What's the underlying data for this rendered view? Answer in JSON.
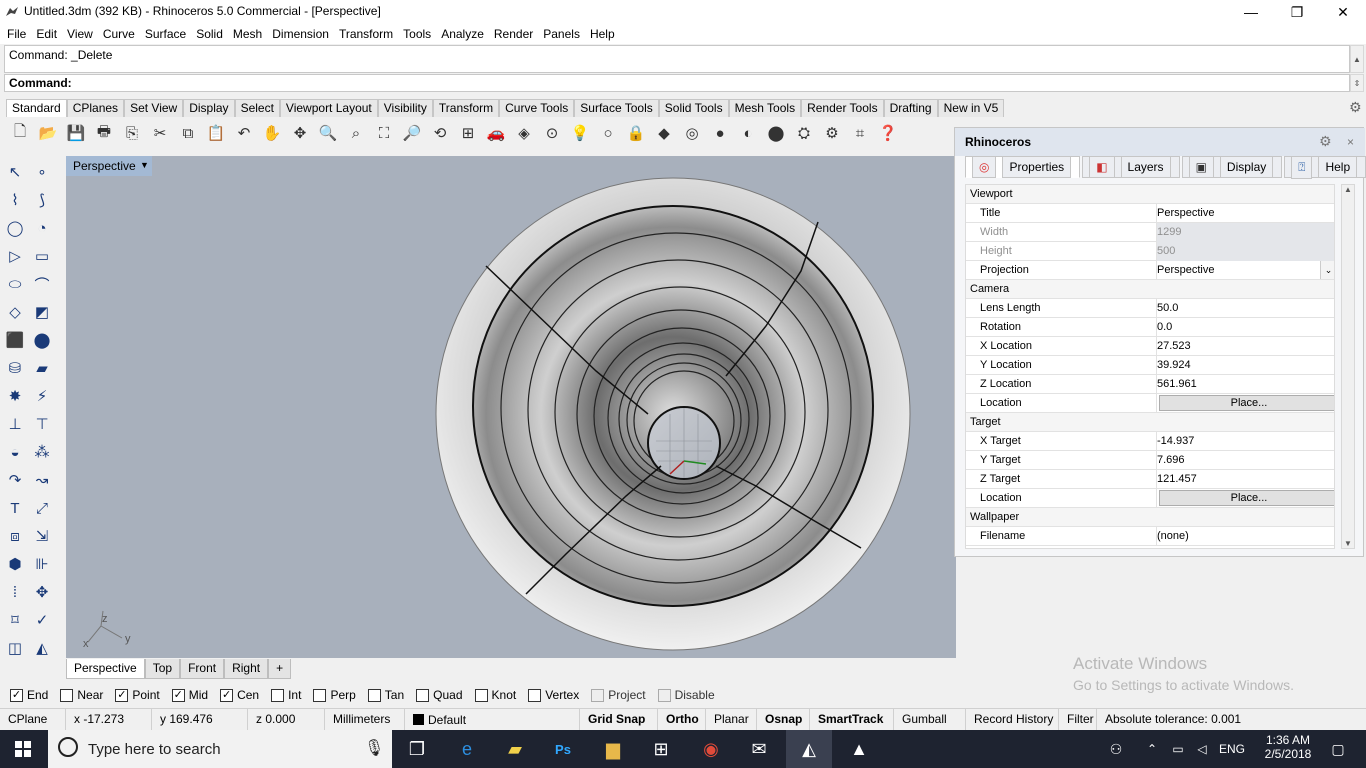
{
  "window": {
    "title": "Untitled.3dm (392 KB) - Rhinoceros 5.0 Commercial - [Perspective]",
    "minimize": "—",
    "restore": "❐",
    "close": "✕"
  },
  "menu": [
    "File",
    "Edit",
    "View",
    "Curve",
    "Surface",
    "Solid",
    "Mesh",
    "Dimension",
    "Transform",
    "Tools",
    "Analyze",
    "Render",
    "Panels",
    "Help"
  ],
  "command": {
    "history": "Command: _Delete",
    "prompt": "Command:"
  },
  "toolbar_tabs": [
    "Standard",
    "CPlanes",
    "Set View",
    "Display",
    "Select",
    "Viewport Layout",
    "Visibility",
    "Transform",
    "Curve Tools",
    "Surface Tools",
    "Solid Tools",
    "Mesh Tools",
    "Render Tools",
    "Drafting",
    "New in V5"
  ],
  "viewport": {
    "title": "Perspective",
    "axes": {
      "x": "x",
      "y": "y",
      "z": "z"
    }
  },
  "viewport_tabs": [
    "Perspective",
    "Top",
    "Front",
    "Right",
    "+"
  ],
  "panel": {
    "title": "Rhinoceros",
    "tabs": [
      "Properties",
      "Layers",
      "Display",
      "Help"
    ],
    "rows": [
      {
        "type": "section",
        "label": "Viewport"
      },
      {
        "label": "Title",
        "value": "Perspective"
      },
      {
        "label": "Width",
        "value": "1299",
        "disabled": true
      },
      {
        "label": "Height",
        "value": "500",
        "disabled": true
      },
      {
        "label": "Projection",
        "value": "Perspective",
        "dropdown": true
      },
      {
        "type": "section",
        "label": "Camera"
      },
      {
        "label": "Lens Length",
        "value": "50.0"
      },
      {
        "label": "Rotation",
        "value": "0.0"
      },
      {
        "label": "X Location",
        "value": "27.523"
      },
      {
        "label": "Y Location",
        "value": "39.924"
      },
      {
        "label": "Z Location",
        "value": "561.961"
      },
      {
        "label": "Location",
        "button": "Place..."
      },
      {
        "type": "section",
        "label": "Target"
      },
      {
        "label": "X Target",
        "value": "-14.937"
      },
      {
        "label": "Y Target",
        "value": "7.696"
      },
      {
        "label": "Z Target",
        "value": "121.457"
      },
      {
        "label": "Location",
        "button": "Place..."
      },
      {
        "type": "section",
        "label": "Wallpaper"
      },
      {
        "label": "Filename",
        "value": "(none)"
      }
    ]
  },
  "osnap": [
    {
      "label": "End",
      "checked": true
    },
    {
      "label": "Near",
      "checked": false
    },
    {
      "label": "Point",
      "checked": true
    },
    {
      "label": "Mid",
      "checked": true
    },
    {
      "label": "Cen",
      "checked": true
    },
    {
      "label": "Int",
      "checked": false
    },
    {
      "label": "Perp",
      "checked": false
    },
    {
      "label": "Tan",
      "checked": false
    },
    {
      "label": "Quad",
      "checked": false
    },
    {
      "label": "Knot",
      "checked": false
    },
    {
      "label": "Vertex",
      "checked": false
    },
    {
      "label": "Project",
      "checked": false,
      "disabled": true
    },
    {
      "label": "Disable",
      "checked": false,
      "disabled": true
    }
  ],
  "status": {
    "cplane": "CPlane",
    "x": "x -17.273",
    "y": "y 169.476",
    "z": "z 0.000",
    "units": "Millimeters",
    "layer": "Default",
    "toggles": [
      "Grid Snap",
      "Ortho",
      "Planar",
      "Osnap",
      "SmartTrack",
      "Gumball",
      "Record History",
      "Filter"
    ],
    "bold_toggles": [
      "Grid Snap",
      "Ortho",
      "Osnap",
      "SmartTrack"
    ],
    "tolerance": "Absolute tolerance: 0.001"
  },
  "watermark": {
    "line1": "Activate Windows",
    "line2": "Go to Settings to activate Windows."
  },
  "taskbar": {
    "search_placeholder": "Type here to search",
    "language": "ENG",
    "time": "1:36 AM",
    "date": "2/5/2018"
  },
  "colors": {
    "viewport_bg": "#a8b0bc",
    "viewport_title_bg": "#a3b9d4",
    "taskbar": "#1e2330"
  }
}
